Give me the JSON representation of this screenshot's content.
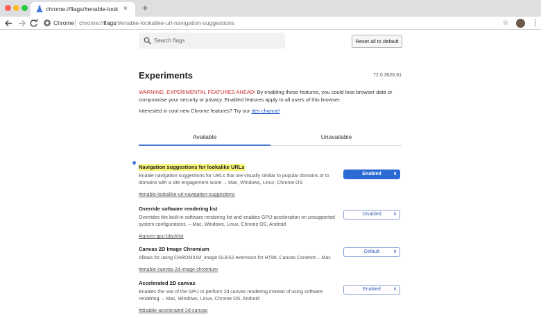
{
  "browser": {
    "tab_title": "chrome://flags/#enable-lookalik",
    "tab_close": "×",
    "new_tab": "+",
    "omnibox_label": "Chrome",
    "url_scheme": "chrome://",
    "url_host": "flags",
    "url_rest": "/#enable-lookalike-url-navigation-suggestions",
    "star_icon": "star-icon",
    "menu_icon": "⋮"
  },
  "header": {
    "search_placeholder": "Search flags",
    "reset_label": "Reset all to default"
  },
  "page": {
    "title": "Experiments",
    "version": "72.0.3626.81",
    "warning_strong": "WARNING: EXPERIMENTAL FEATURES AHEAD!",
    "warning_text": " By enabling these features, you could lose browser data or compromise your security or privacy. Enabled features apply to all users of this browser.",
    "interested_text": "Interested in cool new Chrome features? Try our ",
    "dev_channel": "dev channel"
  },
  "tabs": {
    "available": "Available",
    "unavailable": "Unavailable"
  },
  "experiments": [
    {
      "name": "Navigation suggestions for lookalike URLs",
      "description": "Enable navigation suggestions for URLs that are visually similar to popular domains or to domains with a site engagement score. – Mac, Windows, Linux, Chrome OS",
      "link": "#enable-lookalike-url-navigation-suggestions",
      "value": "Enabled"
    },
    {
      "name": "Override software rendering list",
      "description": "Overrides the built-in software rendering list and enables GPU-acceleration on unsupported system configurations. – Mac, Windows, Linux, Chrome OS, Android",
      "link": "#ignore-gpu-blacklist",
      "value": "Disabled"
    },
    {
      "name": "Canvas 2D Image Chromium",
      "description": "Allows for using CHROMIUM_image GLES2 extension for HTML Canvas Contexts – Mac",
      "link": "#enable-canvas-2d-image-chromium",
      "value": "Default"
    },
    {
      "name": "Accelerated 2D canvas",
      "description": "Enables the use of the GPU to perform 2d canvas rendering instead of using software rendering. – Mac, Windows, Linux, Chrome OS, Android",
      "link": "#disable-accelerated-2d-canvas",
      "value": "Enabled"
    }
  ],
  "colors": {
    "accent": "#2c6ad6",
    "warning": "#c62828",
    "highlight": "#f9f77a"
  }
}
